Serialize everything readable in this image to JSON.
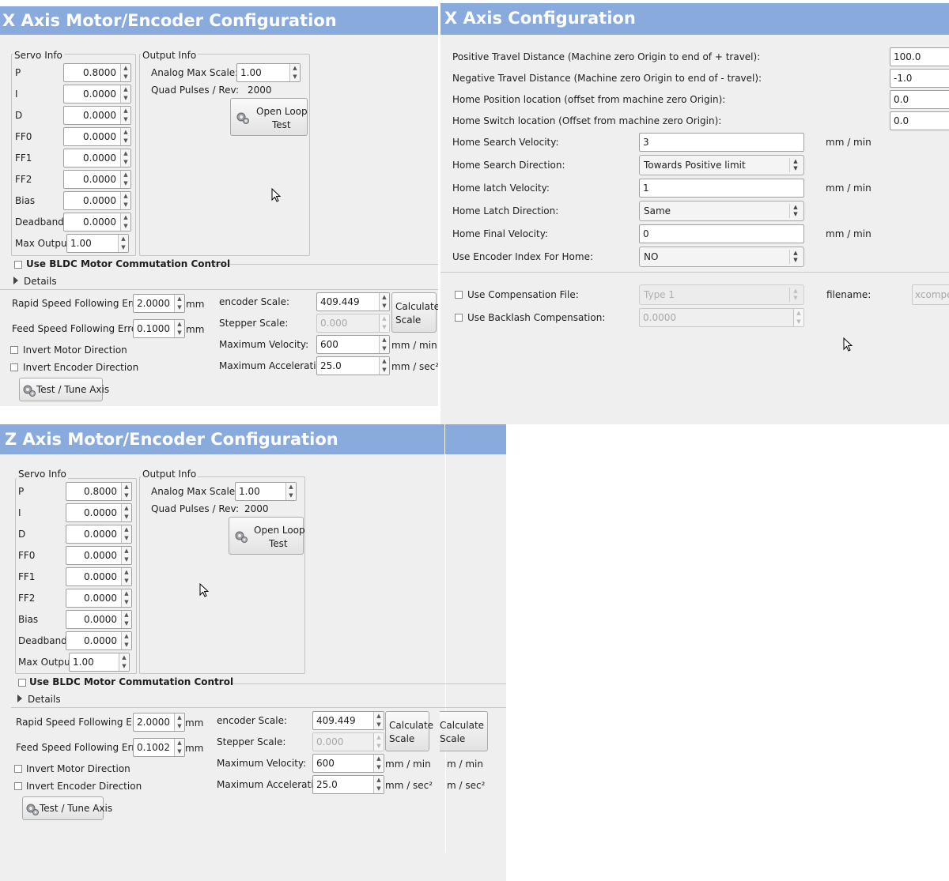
{
  "x_motor": {
    "title": "X Axis Motor/Encoder Configuration",
    "servo_title": "Servo Info",
    "servo_rows": [
      {
        "label": "P",
        "value": "0.8000"
      },
      {
        "label": "I",
        "value": "0.0000"
      },
      {
        "label": "D",
        "value": "0.0000"
      },
      {
        "label": "FF0",
        "value": "0.0000"
      },
      {
        "label": "FF1",
        "value": "0.0000"
      },
      {
        "label": "FF2",
        "value": "0.0000"
      },
      {
        "label": "Bias",
        "value": "0.0000"
      },
      {
        "label": "Deadband",
        "value": "0.0000"
      }
    ],
    "max_output_label": "Max Output",
    "max_output_value": "1.00",
    "output_title": "Output Info",
    "analog_label": "Analog Max Scale:",
    "analog_value": "1.00",
    "quad_label": "Quad Pulses / Rev:",
    "quad_value": "2000",
    "open_loop_line1": "Open Loop",
    "open_loop_line2": "Test",
    "bldc_label": "Use BLDC Motor Commutation Control",
    "details_label": "Details",
    "rapid_label": "Rapid Speed Following Error:",
    "rapid_value": "2.0000",
    "feed_label": "Feed Speed Following Error:",
    "feed_value": "0.1000",
    "mm": "mm",
    "invert_motor": "Invert Motor Direction",
    "invert_encoder": "Invert Encoder Direction",
    "test_tune": "Test / Tune Axis",
    "encoder_label": "encoder Scale:",
    "encoder_value": "409.449",
    "stepper_label": "Stepper Scale:",
    "stepper_value": "0.000",
    "calc_line1": "Calculate",
    "calc_line2": "Scale",
    "maxvel_label": "Maximum Velocity:",
    "maxvel_value": "600",
    "maxvel_unit": "mm / min",
    "maxacc_label": "Maximum Acceleration:",
    "maxacc_value": "25.0",
    "maxacc_unit": "mm / sec²"
  },
  "x_config": {
    "title": "X Axis Configuration",
    "travel_rows": [
      {
        "label": "Positive Travel Distance  (Machine zero Origin to end of + travel):",
        "value": "100.0"
      },
      {
        "label": "Negative Travel Distance  (Machine zero Origin to end of - travel):",
        "value": "-1.0"
      },
      {
        "label": "Home Position location   (offset from machine zero Origin):",
        "value": "0.0"
      },
      {
        "label": "Home Switch location   (Offset from machine zero Origin):",
        "value": "0.0"
      }
    ],
    "home_search_vel_label": "Home Search Velocity:",
    "home_search_vel_value": "3",
    "home_search_dir_label": "Home Search Direction:",
    "home_search_dir_value": "Towards Positive limit",
    "home_latch_vel_label": "Home latch Velocity:",
    "home_latch_vel_value": "1",
    "home_latch_dir_label": "Home Latch Direction:",
    "home_latch_dir_value": "Same",
    "home_final_vel_label": "Home Final Velocity:",
    "home_final_vel_value": "0",
    "encoder_index_label": "Use Encoder Index For Home:",
    "encoder_index_value": "NO",
    "unit": "mm / min",
    "comp_file_label": "Use Compensation File:",
    "comp_type_value": "Type 1",
    "filename_label": "filename:",
    "filename_value": "xcompe",
    "backlash_label": "Use Backlash Compensation:",
    "backlash_value": "0.0000"
  },
  "z_motor": {
    "title": "Z Axis Motor/Encoder Configuration",
    "servo_title": "Servo Info",
    "servo_rows": [
      {
        "label": "P",
        "value": "0.8000"
      },
      {
        "label": "I",
        "value": "0.0000"
      },
      {
        "label": "D",
        "value": "0.0000"
      },
      {
        "label": "FF0",
        "value": "0.0000"
      },
      {
        "label": "FF1",
        "value": "0.0000"
      },
      {
        "label": "FF2",
        "value": "0.0000"
      },
      {
        "label": "Bias",
        "value": "0.0000"
      },
      {
        "label": "Deadband",
        "value": "0.0000"
      }
    ],
    "max_output_label": "Max Output",
    "max_output_value": "1.00",
    "output_title": "Output Info",
    "analog_label": "Analog Max Scale:",
    "analog_value": "1.00",
    "quad_label": "Quad Pulses / Rev:",
    "quad_value": "2000",
    "open_loop_line1": "Open Loop",
    "open_loop_line2": "Test",
    "bldc_label": "Use BLDC Motor Commutation Control",
    "details_label": "Details",
    "rapid_label": "Rapid Speed Following Error:",
    "rapid_value": "2.0000",
    "feed_label": "Feed Speed Following Error:",
    "feed_value": "0.1002",
    "mm": "mm",
    "invert_motor": "Invert Motor Direction",
    "invert_encoder": "Invert Encoder Direction",
    "test_tune": "Test / Tune Axis",
    "encoder_label": "encoder Scale:",
    "encoder_value": "409.449",
    "stepper_label": "Stepper Scale:",
    "stepper_value": "0.000",
    "calc_line1": "Calculate",
    "calc_line2": "Scale",
    "maxvel_label": "Maximum Velocity:",
    "maxvel_value": "600",
    "maxvel_unit": "mm / min",
    "maxacc_label": "Maximum Acceleration:",
    "maxacc_value": "25.0",
    "maxacc_unit": "mm / sec²",
    "ghost_calc_line1": "Calculate",
    "ghost_calc_line2": "Scale",
    "ghost_vel_unit": "m / min",
    "ghost_acc_unit": "m / sec²"
  },
  "colors": {
    "titlebar": "#88aadd",
    "panel": "#efefef"
  }
}
